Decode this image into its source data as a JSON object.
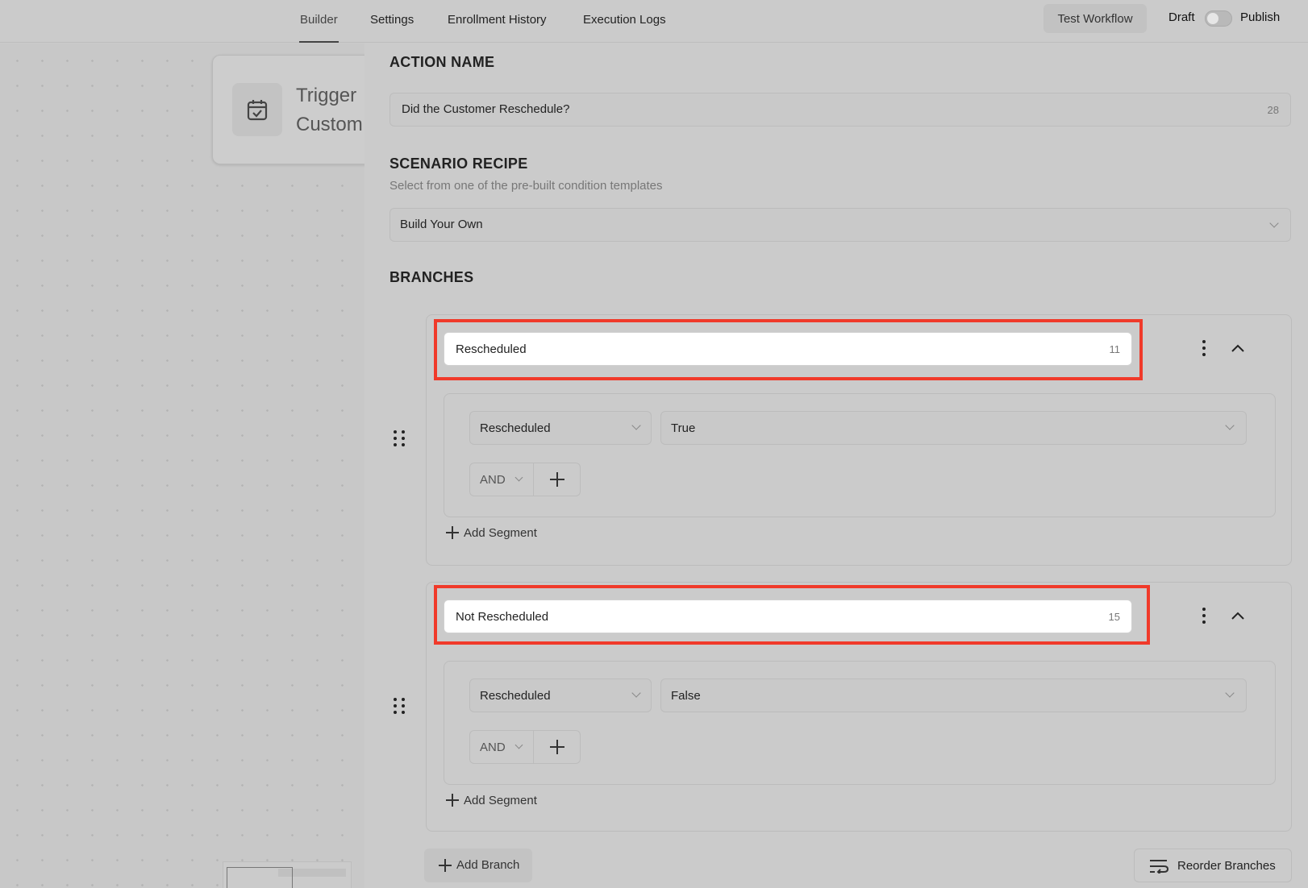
{
  "nav": {
    "tabs": [
      {
        "label": "Builder",
        "active": true
      },
      {
        "label": "Settings",
        "active": false
      },
      {
        "label": "Enrollment History",
        "active": false
      },
      {
        "label": "Execution Logs",
        "active": false
      }
    ],
    "test_workflow": "Test Workflow",
    "draft_label": "Draft",
    "publish_label": "Publish",
    "publish_toggle_on": false
  },
  "canvas": {
    "trigger_card": {
      "icon": "calendar-check-icon",
      "title": "Trigger",
      "subtitle": "Custom"
    }
  },
  "panel": {
    "action_name": {
      "title": "ACTION NAME",
      "value": "Did the Customer Reschedule?",
      "counter": "28"
    },
    "scenario_recipe": {
      "title": "SCENARIO RECIPE",
      "hint": "Select from one of the pre-built condition templates",
      "selected": "Build Your Own"
    },
    "branches_title": "BRANCHES",
    "branches": [
      {
        "name": "Rescheduled",
        "counter": "11",
        "condition_field": "Rescheduled",
        "condition_value": "True",
        "operator": "AND",
        "add_segment": "Add Segment"
      },
      {
        "name": "Not Rescheduled",
        "counter": "15",
        "condition_field": "Rescheduled",
        "condition_value": "False",
        "operator": "AND",
        "add_segment": "Add Segment"
      }
    ],
    "add_branch": "Add Branch",
    "reorder_branches": "Reorder Branches"
  },
  "colors": {
    "highlight": "#f03a2a",
    "overlay_gray": "#cbcbcb"
  }
}
